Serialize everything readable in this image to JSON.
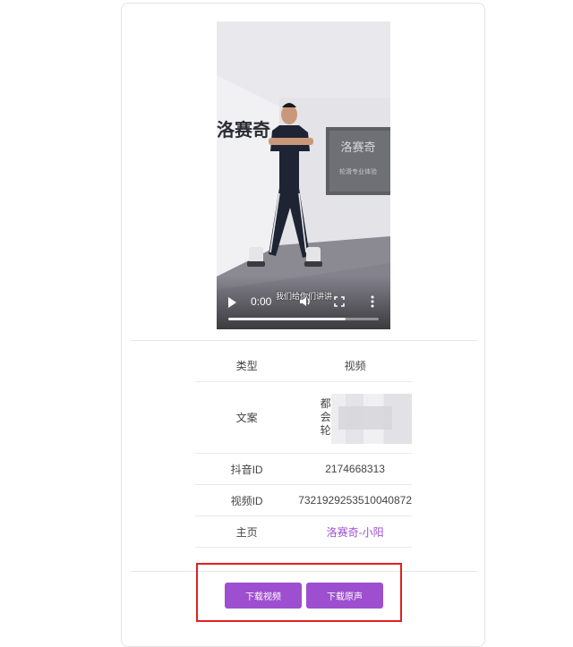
{
  "video": {
    "time": "0:00",
    "caption": "我们给你们讲讲",
    "progress_fraction": 0.78,
    "wall_sign": "洛赛奇",
    "board_title": "洛赛奇",
    "board_subtitle": "轮滑专业体验"
  },
  "info": {
    "type_label": "类型",
    "type_value": "视频",
    "text_label": "文案",
    "text_lines": [
      "都20",
      "会了",
      "轮滑"
    ],
    "douyin_id_label": "抖音ID",
    "douyin_id_value": "2174668313",
    "video_id_label": "视频ID",
    "video_id_value": "7321929253510040872",
    "home_label": "主页",
    "home_value": "洛赛奇-小阳"
  },
  "actions": {
    "download_video": "下载视频",
    "download_audio": "下载原声"
  },
  "colors": {
    "accent": "#9d4fcf",
    "link": "#9b4fd1",
    "highlight_border": "#e02020"
  }
}
